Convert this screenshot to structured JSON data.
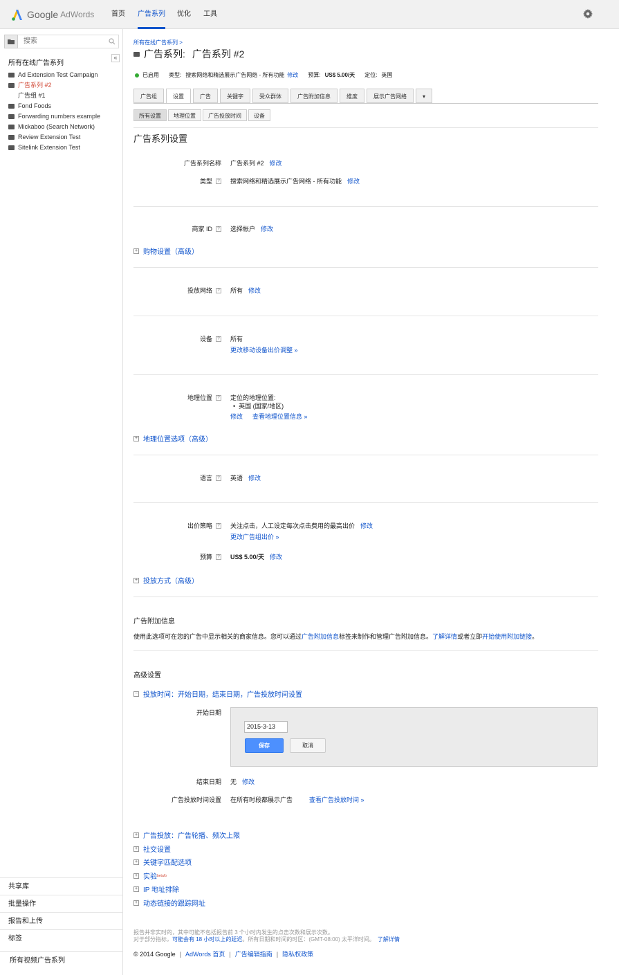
{
  "header": {
    "logo_google": "Google",
    "logo_adwords": "AdWords",
    "nav": [
      "首页",
      "广告系列",
      "优化",
      "工具"
    ],
    "active_nav": "广告系列",
    "settings_icon": "gear-icon"
  },
  "sidebar": {
    "search_placeholder": "搜索",
    "collapse_label": "«",
    "all_campaigns": "所有在线广告系列",
    "tree": [
      {
        "label": "Ad Extension Test Campaign",
        "active": false,
        "child": false
      },
      {
        "label": "广告系列 #2",
        "active": true,
        "child": false
      },
      {
        "label": "广告组 #1",
        "active": false,
        "child": true
      },
      {
        "label": "Fond Foods",
        "active": false,
        "child": false
      },
      {
        "label": "Forwarding numbers example",
        "active": false,
        "child": false
      },
      {
        "label": "Mickaboo (Search Network)",
        "active": false,
        "child": false
      },
      {
        "label": "Review Extension Test",
        "active": false,
        "child": false
      },
      {
        "label": "Sitelink Extension Test",
        "active": false,
        "child": false
      }
    ],
    "bottom": [
      "共享库",
      "批量操作",
      "报告和上传",
      "标签",
      "所有视频广告系列"
    ]
  },
  "main": {
    "breadcrumb": "所有在线广告系列 >",
    "title_prefix": "广告系列:",
    "title_name": "广告系列 #2",
    "status": {
      "state": "已启用",
      "type_label": "类型:",
      "type_value": "搜索网络和精选展示广告网络 - 所有功能",
      "edit": "修改",
      "budget_label": "预算:",
      "budget_value": "US$ 5.00/天",
      "location_label": "定位:",
      "location_value": "英国"
    },
    "tabs": [
      "广告组",
      "设置",
      "广告",
      "关键字",
      "受众群体",
      "广告附加信息",
      "维度",
      "展示广告网络",
      "▾"
    ],
    "active_tab": "设置",
    "subtabs": [
      "所有设置",
      "地理位置",
      "广告投放时间",
      "设备"
    ],
    "active_subtab": "所有设置",
    "settings_title": "广告系列设置",
    "edit": "修改",
    "fields": {
      "name_label": "广告系列名称",
      "name_value": "广告系列 #2",
      "type_label": "类型",
      "type_value": "搜索网络和精选展示广告网络 - 所有功能",
      "merchant_label": "商家 ID",
      "merchant_value": "选择帐户",
      "shopping_expander": "购物设置（高级）",
      "networks_label": "投放网络",
      "networks_value": "所有",
      "devices_label": "设备",
      "devices_value": "所有",
      "devices_link": "更改移动设备出价调整 »",
      "location_label": "地理位置",
      "location_value": "定位的地理位置:",
      "location_item": "英国 (国家/地区)",
      "location_link": "查看地理位置信息 »",
      "location_expander": "地理位置选项（高级）",
      "language_label": "语言",
      "language_value": "英语",
      "bid_label": "出价策略",
      "bid_value": "关注点击，人工设定每次点击费用的最高出价",
      "bid_link": "更改广告组出价 »",
      "budget_label": "预算",
      "budget_value": "US$ 5.00/天",
      "delivery_expander": "投放方式（高级）"
    },
    "ext_title": "广告附加信息",
    "ext_text_1": "使用此选项可在您的广告中显示相关的商家信息。您可以通过",
    "ext_link_1": "广告附加信息",
    "ext_text_2": "标签来制作和管理广告附加信息。",
    "ext_link_2": "了解详情",
    "ext_text_3": "或者立即",
    "ext_link_3": "开始使用附加链接",
    "ext_text_4": "。",
    "adv_title": "高级设置",
    "schedule_expander": "投放时间：开始日期，结束日期，广告投放时间设置",
    "start_label": "开始日期",
    "start_value": "2015-3-13",
    "save": "保存",
    "cancel": "取消",
    "end_label": "结束日期",
    "end_value": "无",
    "adsched_label": "广告投放时间设置",
    "adsched_value": "在所有时段都展示广告",
    "adsched_link": "查看广告投放时间 »",
    "more_expanders": [
      "广告投放：广告轮播、频次上限",
      "社交设置",
      "关键字匹配选项",
      "实验",
      "IP 地址排除",
      "动态链接的跟踪网址"
    ],
    "beta_tag": "beta/b",
    "footer_note_1": "报告并非实时的，其中可能不包括报告前 3 个小时内发生的点击次数和展示次数。",
    "footer_note_2a": "对于部分指标，",
    "footer_note_2b": "可能会有 18 小时以上的延迟",
    "footer_note_2c": "。所有日期和时间的时区：(GMT-08:00) 太平洋时间。",
    "footer_note_2d": "了解详情",
    "footer_links": [
      "© 2014 Google",
      "AdWords 首页",
      "广告编辑指南",
      "隐私权政策"
    ]
  },
  "colors": {
    "accent": "#1155cc",
    "active_red": "#d14836",
    "primary_button": "#4d90fe",
    "status_green": "#33aa33"
  }
}
